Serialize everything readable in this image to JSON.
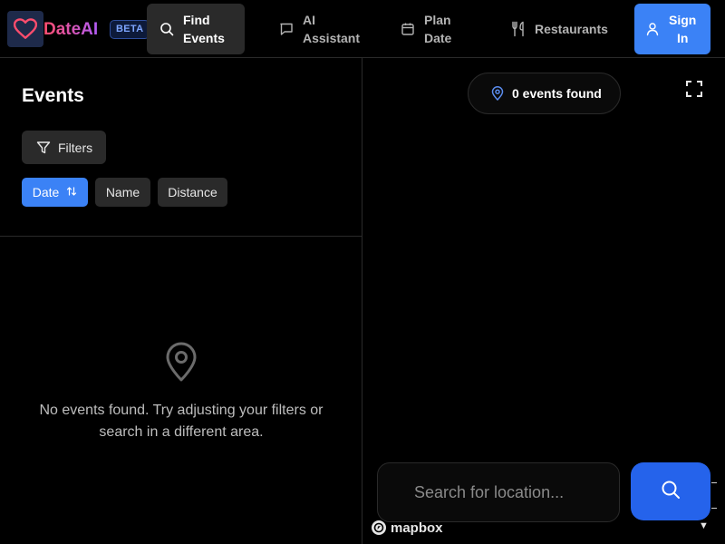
{
  "header": {
    "brand": "DateAI",
    "badge": "BETA",
    "nav": [
      {
        "label": "Find\nEvents",
        "icon": "search-icon",
        "active": true
      },
      {
        "label": "AI\nAssistant",
        "icon": "chat-icon",
        "active": false
      },
      {
        "label": "Plan\nDate",
        "icon": "calendar-icon",
        "active": false
      },
      {
        "label": "Restaurants",
        "icon": "fork-knife-icon",
        "active": false
      }
    ],
    "sign_in": "Sign\nIn"
  },
  "sidebar": {
    "title": "Events",
    "filters_label": "Filters",
    "sort": [
      {
        "label": "Date",
        "active": true
      },
      {
        "label": "Name",
        "active": false
      },
      {
        "label": "Distance",
        "active": false
      }
    ],
    "empty_message": "No events found. Try adjusting your filters or search in a different area."
  },
  "map": {
    "events_found": "0 events found",
    "search_placeholder": "Search for location...",
    "attribution": "mapbox",
    "collapse_arrow": "▼"
  },
  "colors": {
    "accent": "#3b82f6",
    "search_button": "#2563eb",
    "surface": "#2a2a2a",
    "background": "#000000"
  }
}
